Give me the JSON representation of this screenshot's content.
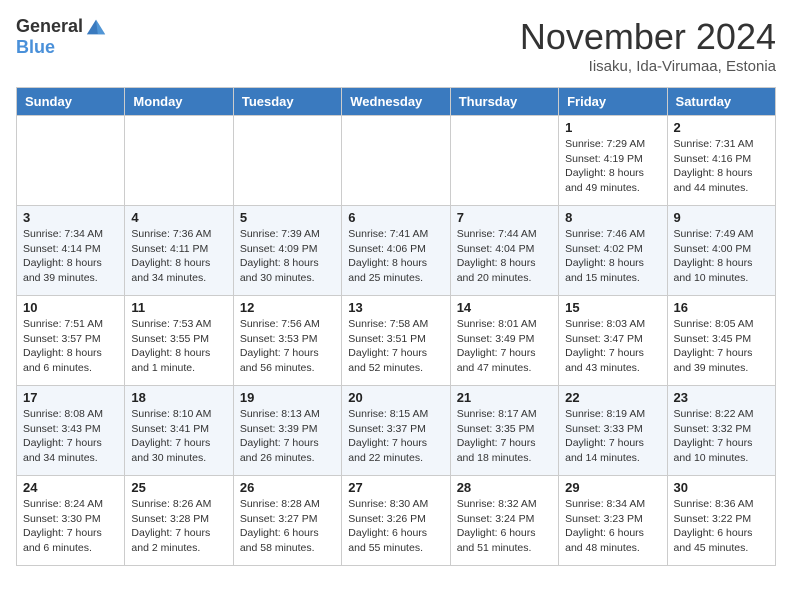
{
  "header": {
    "logo_general": "General",
    "logo_blue": "Blue",
    "month_title": "November 2024",
    "location": "Iisaku, Ida-Virumaa, Estonia"
  },
  "days_of_week": [
    "Sunday",
    "Monday",
    "Tuesday",
    "Wednesday",
    "Thursday",
    "Friday",
    "Saturday"
  ],
  "weeks": [
    [
      {
        "day": "",
        "info": ""
      },
      {
        "day": "",
        "info": ""
      },
      {
        "day": "",
        "info": ""
      },
      {
        "day": "",
        "info": ""
      },
      {
        "day": "",
        "info": ""
      },
      {
        "day": "1",
        "info": "Sunrise: 7:29 AM\nSunset: 4:19 PM\nDaylight: 8 hours and 49 minutes."
      },
      {
        "day": "2",
        "info": "Sunrise: 7:31 AM\nSunset: 4:16 PM\nDaylight: 8 hours and 44 minutes."
      }
    ],
    [
      {
        "day": "3",
        "info": "Sunrise: 7:34 AM\nSunset: 4:14 PM\nDaylight: 8 hours and 39 minutes."
      },
      {
        "day": "4",
        "info": "Sunrise: 7:36 AM\nSunset: 4:11 PM\nDaylight: 8 hours and 34 minutes."
      },
      {
        "day": "5",
        "info": "Sunrise: 7:39 AM\nSunset: 4:09 PM\nDaylight: 8 hours and 30 minutes."
      },
      {
        "day": "6",
        "info": "Sunrise: 7:41 AM\nSunset: 4:06 PM\nDaylight: 8 hours and 25 minutes."
      },
      {
        "day": "7",
        "info": "Sunrise: 7:44 AM\nSunset: 4:04 PM\nDaylight: 8 hours and 20 minutes."
      },
      {
        "day": "8",
        "info": "Sunrise: 7:46 AM\nSunset: 4:02 PM\nDaylight: 8 hours and 15 minutes."
      },
      {
        "day": "9",
        "info": "Sunrise: 7:49 AM\nSunset: 4:00 PM\nDaylight: 8 hours and 10 minutes."
      }
    ],
    [
      {
        "day": "10",
        "info": "Sunrise: 7:51 AM\nSunset: 3:57 PM\nDaylight: 8 hours and 6 minutes."
      },
      {
        "day": "11",
        "info": "Sunrise: 7:53 AM\nSunset: 3:55 PM\nDaylight: 8 hours and 1 minute."
      },
      {
        "day": "12",
        "info": "Sunrise: 7:56 AM\nSunset: 3:53 PM\nDaylight: 7 hours and 56 minutes."
      },
      {
        "day": "13",
        "info": "Sunrise: 7:58 AM\nSunset: 3:51 PM\nDaylight: 7 hours and 52 minutes."
      },
      {
        "day": "14",
        "info": "Sunrise: 8:01 AM\nSunset: 3:49 PM\nDaylight: 7 hours and 47 minutes."
      },
      {
        "day": "15",
        "info": "Sunrise: 8:03 AM\nSunset: 3:47 PM\nDaylight: 7 hours and 43 minutes."
      },
      {
        "day": "16",
        "info": "Sunrise: 8:05 AM\nSunset: 3:45 PM\nDaylight: 7 hours and 39 minutes."
      }
    ],
    [
      {
        "day": "17",
        "info": "Sunrise: 8:08 AM\nSunset: 3:43 PM\nDaylight: 7 hours and 34 minutes."
      },
      {
        "day": "18",
        "info": "Sunrise: 8:10 AM\nSunset: 3:41 PM\nDaylight: 7 hours and 30 minutes."
      },
      {
        "day": "19",
        "info": "Sunrise: 8:13 AM\nSunset: 3:39 PM\nDaylight: 7 hours and 26 minutes."
      },
      {
        "day": "20",
        "info": "Sunrise: 8:15 AM\nSunset: 3:37 PM\nDaylight: 7 hours and 22 minutes."
      },
      {
        "day": "21",
        "info": "Sunrise: 8:17 AM\nSunset: 3:35 PM\nDaylight: 7 hours and 18 minutes."
      },
      {
        "day": "22",
        "info": "Sunrise: 8:19 AM\nSunset: 3:33 PM\nDaylight: 7 hours and 14 minutes."
      },
      {
        "day": "23",
        "info": "Sunrise: 8:22 AM\nSunset: 3:32 PM\nDaylight: 7 hours and 10 minutes."
      }
    ],
    [
      {
        "day": "24",
        "info": "Sunrise: 8:24 AM\nSunset: 3:30 PM\nDaylight: 7 hours and 6 minutes."
      },
      {
        "day": "25",
        "info": "Sunrise: 8:26 AM\nSunset: 3:28 PM\nDaylight: 7 hours and 2 minutes."
      },
      {
        "day": "26",
        "info": "Sunrise: 8:28 AM\nSunset: 3:27 PM\nDaylight: 6 hours and 58 minutes."
      },
      {
        "day": "27",
        "info": "Sunrise: 8:30 AM\nSunset: 3:26 PM\nDaylight: 6 hours and 55 minutes."
      },
      {
        "day": "28",
        "info": "Sunrise: 8:32 AM\nSunset: 3:24 PM\nDaylight: 6 hours and 51 minutes."
      },
      {
        "day": "29",
        "info": "Sunrise: 8:34 AM\nSunset: 3:23 PM\nDaylight: 6 hours and 48 minutes."
      },
      {
        "day": "30",
        "info": "Sunrise: 8:36 AM\nSunset: 3:22 PM\nDaylight: 6 hours and 45 minutes."
      }
    ]
  ]
}
